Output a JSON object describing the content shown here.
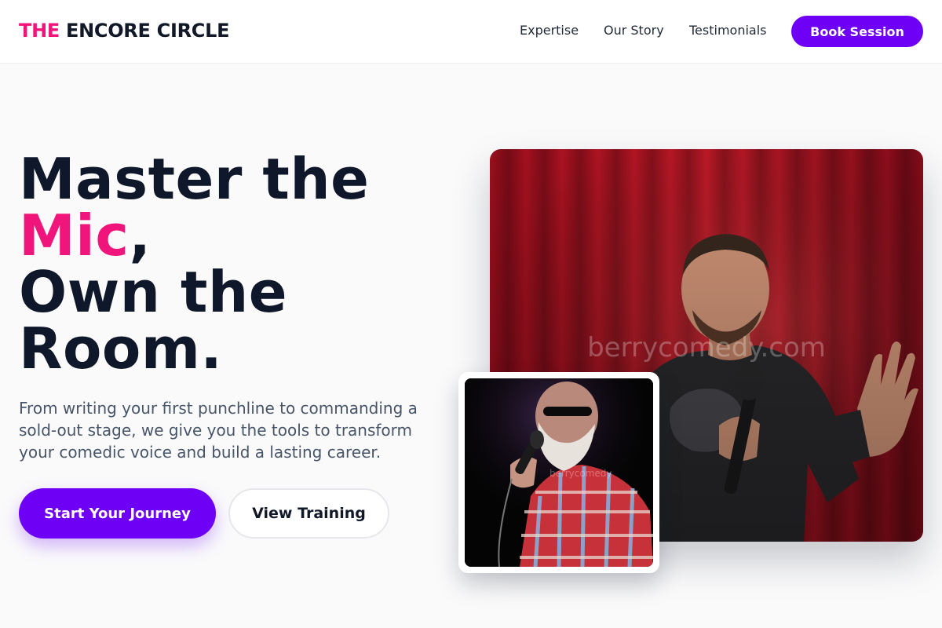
{
  "brand": {
    "part1": "THE",
    "part2": "ENCORE CIRCLE"
  },
  "nav": {
    "links": [
      "Expertise",
      "Our Story",
      "Testimonials"
    ],
    "cta": "Book Session"
  },
  "hero": {
    "headline": {
      "line1": "Master the",
      "highlight": "Mic",
      "comma": ",",
      "line3": "Own the",
      "line4": "Room."
    },
    "subtext": "From writing your first punchline to commanding a sold-out stage, we give you the tools to transform your comedic voice and build a lasting career.",
    "primary_cta": "Start Your Journey",
    "secondary_cta": "View Training"
  },
  "images": {
    "main_watermark": "berrycomedy.com",
    "small_watermark": "berrycomedy"
  },
  "colors": {
    "brand_pink": "#f0157a",
    "brand_purple": "#6d00f5",
    "heading": "#0f172a",
    "body_text": "#475569",
    "page_background": "#fafafb"
  }
}
